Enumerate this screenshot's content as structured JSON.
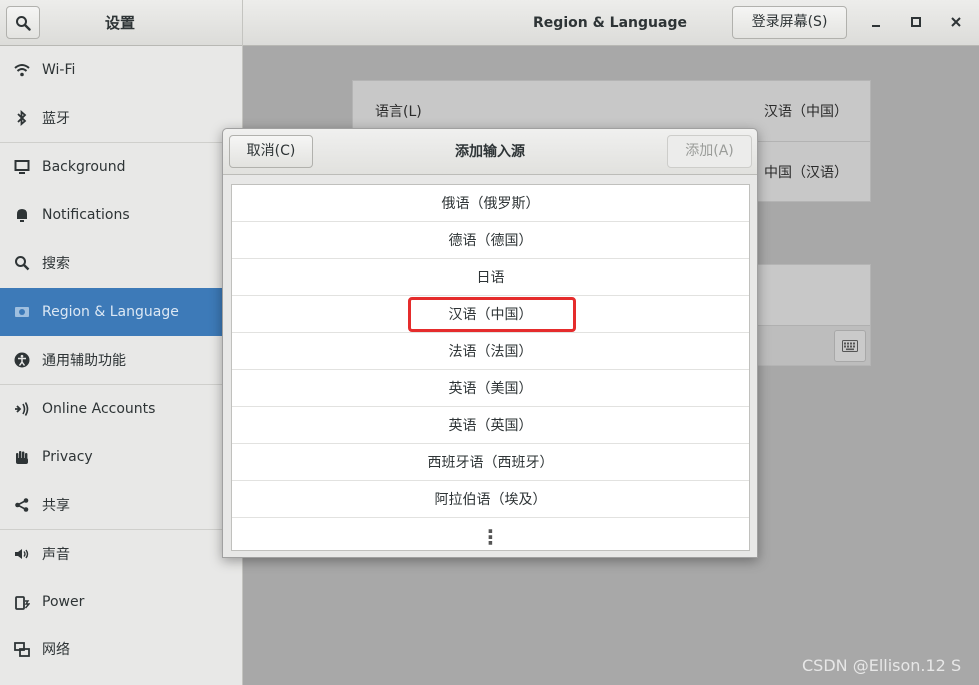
{
  "header": {
    "app_title": "设置",
    "page_title": "Region & Language",
    "login_screen_button": "登录屏幕(S)",
    "icons": [
      "search-icon",
      "minimize-icon",
      "maximize-icon",
      "close-icon"
    ]
  },
  "sidebar": {
    "items": [
      {
        "label": "Wi-Fi",
        "icon": "wifi-icon"
      },
      {
        "label": "蓝牙",
        "icon": "bluetooth-icon"
      },
      {
        "label": "Background",
        "icon": "background-icon"
      },
      {
        "label": "Notifications",
        "icon": "bell-icon"
      },
      {
        "label": "搜索",
        "icon": "search-icon"
      },
      {
        "label": "Region & Language",
        "icon": "region-icon",
        "selected": true
      },
      {
        "label": "通用辅助功能",
        "icon": "accessibility-icon"
      },
      {
        "label": "Online Accounts",
        "icon": "online-accounts-icon"
      },
      {
        "label": "Privacy",
        "icon": "privacy-hand-icon"
      },
      {
        "label": "共享",
        "icon": "share-icon"
      },
      {
        "label": "声音",
        "icon": "speaker-icon"
      },
      {
        "label": "Power",
        "icon": "power-icon"
      },
      {
        "label": "网络",
        "icon": "network-icon"
      }
    ]
  },
  "main": {
    "language_label": "语言(L)",
    "language_value": "汉语（中国）",
    "formats_value": "中国（汉语）"
  },
  "dialog": {
    "title": "添加输入源",
    "cancel_label": "取消(C)",
    "add_label": "添加(A)",
    "items": [
      "俄语（俄罗斯）",
      "德语（德国）",
      "日语",
      "汉语（中国）",
      "法语（法国）",
      "英语（美国）",
      "英语（英国）",
      "西班牙语（西班牙）",
      "阿拉伯语（埃及）"
    ],
    "highlighted_item": "汉语（中国）",
    "more_glyph": "⋮"
  },
  "watermark": "CSDN @Ellison.12 S",
  "colors": {
    "selection": "#3d7ab8",
    "highlight_box": "#e52c2c",
    "overlay_bg": "#a8a8a8"
  }
}
